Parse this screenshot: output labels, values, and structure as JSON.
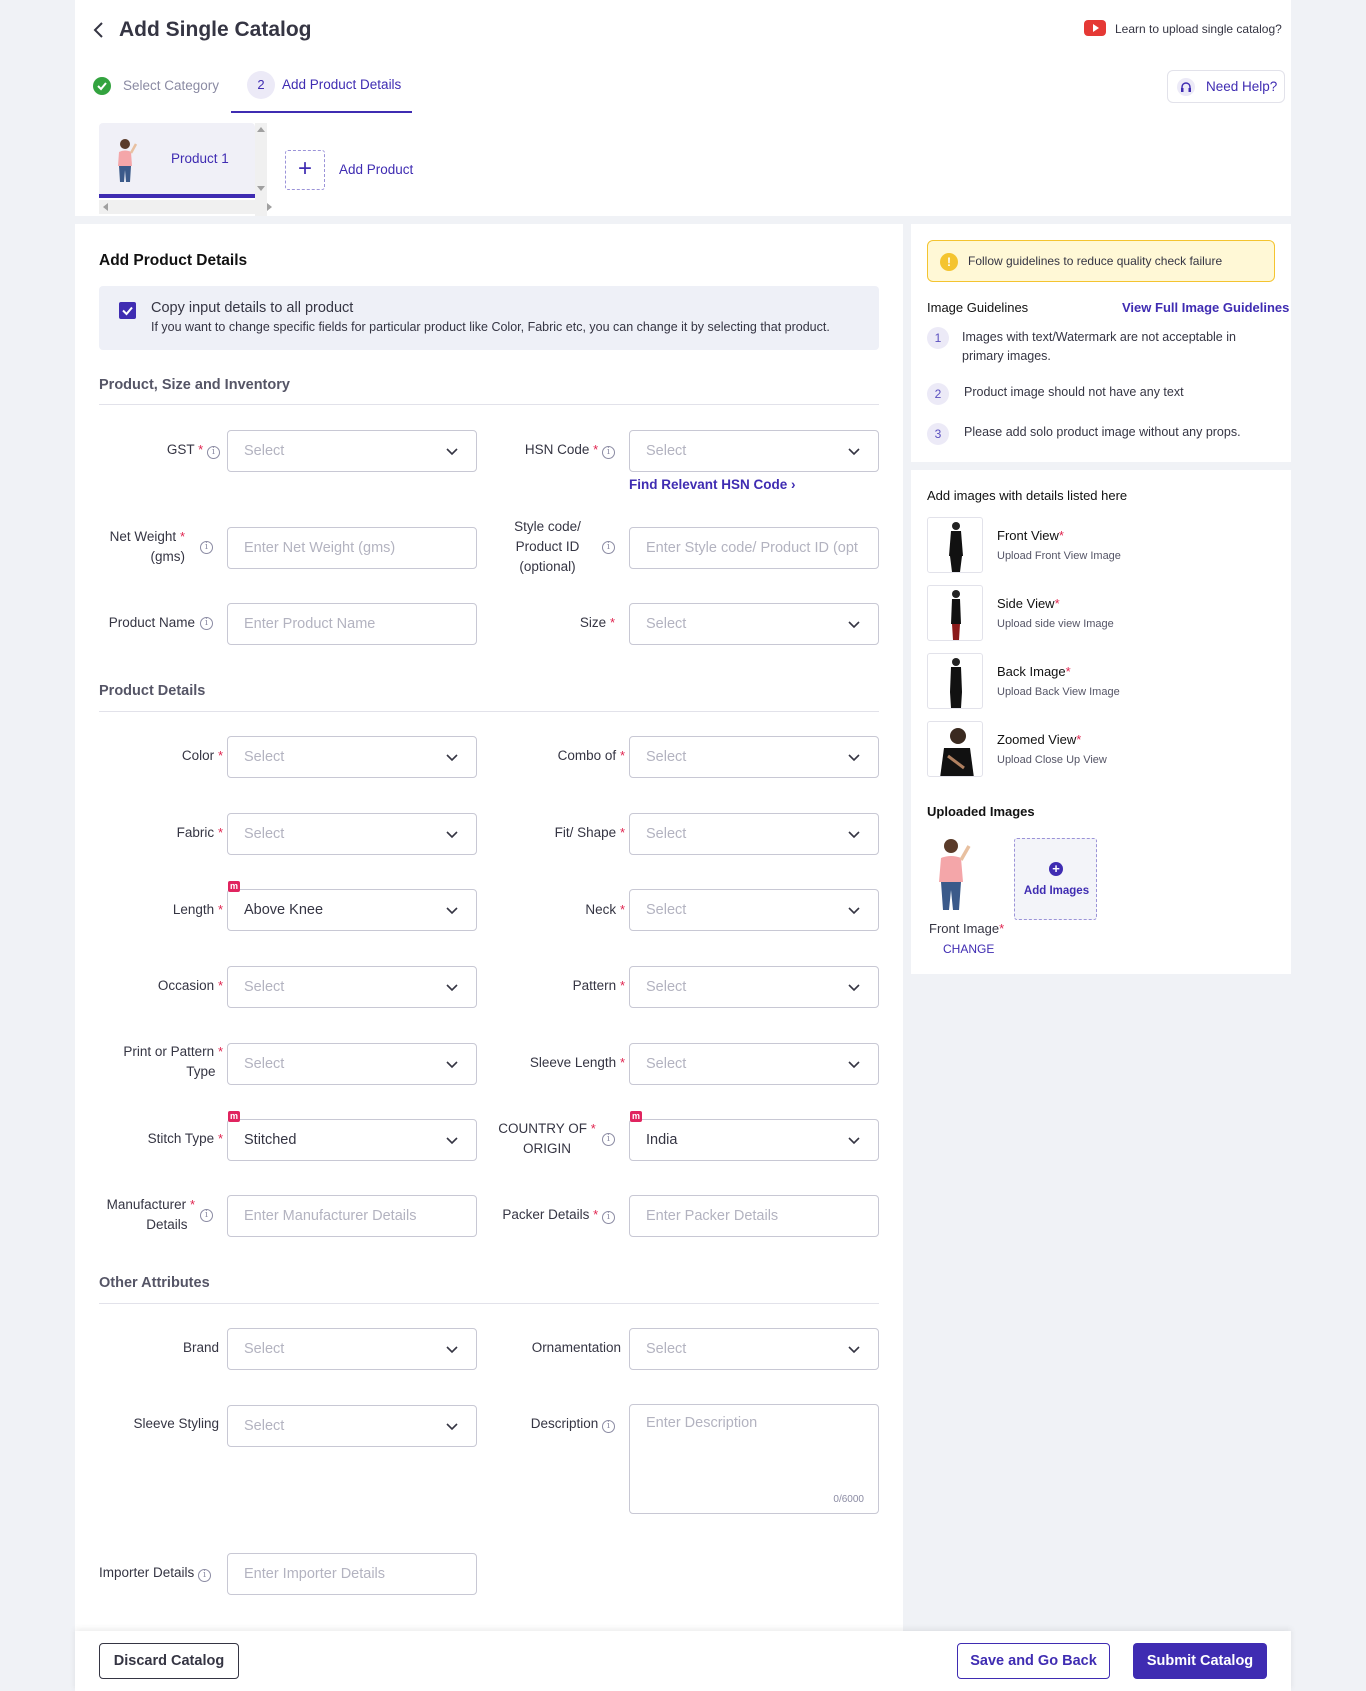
{
  "header": {
    "title": "Add Single Catalog",
    "learn_link": "Learn to upload single catalog?",
    "need_help": "Need Help?"
  },
  "steps": {
    "step1": "Select Category",
    "step2_num": "2",
    "step2": "Add Product Details"
  },
  "products": {
    "product1": "Product 1",
    "add_product": "Add Product"
  },
  "form": {
    "title": "Add Product Details",
    "copy_title": "Copy input details to all product",
    "copy_desc": "If you want to change specific fields for particular product like Color, Fabric etc, you can change it by selecting that product.",
    "section1": "Product, Size and Inventory",
    "section2": "Product Details",
    "section3": "Other Attributes",
    "find_hsn": "Find Relevant HSN Code",
    "labels": {
      "gst": "GST",
      "hsn": "HSN Code",
      "net_weight_1": "Net Weight",
      "net_weight_2": "(gms)",
      "style_1": "Style code/",
      "style_2": "Product ID",
      "style_3": "(optional)",
      "product_name": "Product Name",
      "size": "Size",
      "color": "Color",
      "combo": "Combo of",
      "fabric": "Fabric",
      "fit": "Fit/ Shape",
      "length": "Length",
      "neck": "Neck",
      "occasion": "Occasion",
      "pattern": "Pattern",
      "print_1": "Print or Pattern",
      "print_2": "Type",
      "sleeve_length": "Sleeve Length",
      "stitch": "Stitch Type",
      "country_1": "COUNTRY OF",
      "country_2": "ORIGIN",
      "manufacturer_1": "Manufacturer",
      "manufacturer_2": "Details",
      "packer": "Packer Details",
      "brand": "Brand",
      "ornamentation": "Ornamentation",
      "sleeve_styling": "Sleeve Styling",
      "description": "Description",
      "importer": "Importer Details"
    },
    "values": {
      "select": "Select",
      "net_weight_ph": "Enter Net Weight (gms)",
      "style_ph": "Enter Style code/ Product ID (opt",
      "product_name_ph": "Enter Product Name",
      "length": "Above Knee",
      "stitch": "Stitched",
      "country": "India",
      "manufacturer_ph": "Enter Manufacturer Details",
      "packer_ph": "Enter Packer Details",
      "description_ph": "Enter Description",
      "description_count": "0/6000",
      "importer_ph": "Enter Importer Details"
    }
  },
  "guidelines": {
    "banner": "Follow guidelines to reduce quality check failure",
    "title": "Image Guidelines",
    "view_full": "View Full Image Guidelines",
    "items": [
      {
        "num": "1",
        "text1": "Images with text/Watermark are not acceptable in",
        "text2": "primary images."
      },
      {
        "num": "2",
        "text1": "Product image should not have any text"
      },
      {
        "num": "3",
        "text1": "Please add solo product image without any props."
      }
    ]
  },
  "images": {
    "title": "Add images with details listed here",
    "views": [
      {
        "name": "Front View",
        "sub": "Upload Front View Image"
      },
      {
        "name": "Side View",
        "sub": "Upload side view Image"
      },
      {
        "name": "Back Image",
        "sub": "Upload Back View Image"
      },
      {
        "name": "Zoomed View",
        "sub": "Upload Close Up View"
      }
    ],
    "uploaded_title": "Uploaded Images",
    "front_image": "Front Image",
    "change": "CHANGE",
    "add_images": "Add Images"
  },
  "footer": {
    "discard": "Discard Catalog",
    "save": "Save and Go Back",
    "submit": "Submit Catalog"
  },
  "colors": {
    "accent": "#3f2cb2",
    "required": "#e0244f",
    "banner_bg": "#fff8d6",
    "banner_border": "#f4c430"
  }
}
